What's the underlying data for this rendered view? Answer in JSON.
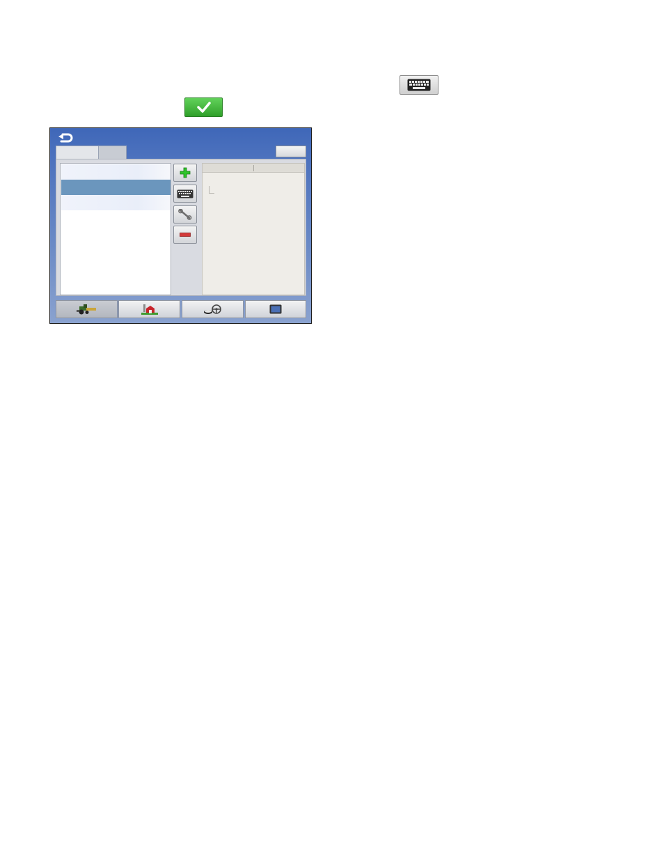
{
  "document": {
    "keyboard_icon": "keyboard-icon",
    "check_icon": "checkmark-icon"
  },
  "screen": {
    "back_icon": "back-arrow-icon",
    "tabs": [
      {
        "label": ""
      },
      {
        "label": ""
      }
    ],
    "top_right_button": {
      "label": ""
    },
    "list_items": [
      {
        "label": ""
      },
      {
        "label": "",
        "selected": true
      },
      {
        "label": ""
      }
    ],
    "side_buttons": [
      {
        "icon": "plus-icon"
      },
      {
        "icon": "keyboard-icon"
      },
      {
        "icon": "wrench-icon"
      },
      {
        "icon": "minus-icon"
      }
    ],
    "detail_columns": [
      "",
      ""
    ],
    "bottom_nav": [
      {
        "icon": "vehicle-icon",
        "active": true
      },
      {
        "icon": "farm-icon"
      },
      {
        "icon": "guidance-icon"
      },
      {
        "icon": "display-icon"
      }
    ]
  },
  "colors": {
    "screen_blue": "#4a70bd",
    "selected_row": "#6b96bd",
    "add_green": "#2fc42a",
    "remove_red": "#d23a3a"
  }
}
